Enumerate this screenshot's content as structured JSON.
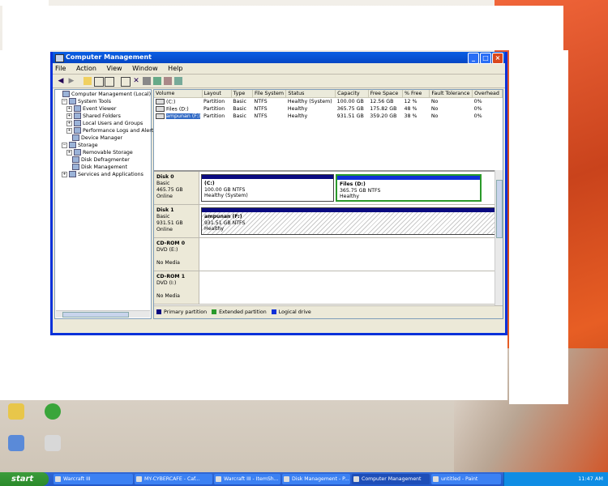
{
  "window": {
    "title": "Computer Management",
    "menu": [
      "File",
      "Action",
      "View",
      "Window",
      "Help"
    ]
  },
  "tree": [
    {
      "label": "Computer Management (Local)",
      "indent": 0,
      "expander": ""
    },
    {
      "label": "System Tools",
      "indent": 1,
      "expander": "−"
    },
    {
      "label": "Event Viewer",
      "indent": 2,
      "expander": "+"
    },
    {
      "label": "Shared Folders",
      "indent": 2,
      "expander": "+"
    },
    {
      "label": "Local Users and Groups",
      "indent": 2,
      "expander": "+"
    },
    {
      "label": "Performance Logs and Alerts",
      "indent": 2,
      "expander": "+"
    },
    {
      "label": "Device Manager",
      "indent": 2,
      "expander": ""
    },
    {
      "label": "Storage",
      "indent": 1,
      "expander": "−"
    },
    {
      "label": "Removable Storage",
      "indent": 2,
      "expander": "+"
    },
    {
      "label": "Disk Defragmenter",
      "indent": 2,
      "expander": ""
    },
    {
      "label": "Disk Management",
      "indent": 2,
      "expander": ""
    },
    {
      "label": "Services and Applications",
      "indent": 1,
      "expander": "+"
    }
  ],
  "volumes": {
    "columns": [
      "Volume",
      "Layout",
      "Type",
      "File System",
      "Status",
      "Capacity",
      "Free Space",
      "% Free",
      "Fault Tolerance",
      "Overhead"
    ],
    "rows": [
      [
        "(C:)",
        "Partition",
        "Basic",
        "NTFS",
        "Healthy (System)",
        "100.00 GB",
        "12.56 GB",
        "12 %",
        "No",
        "0%"
      ],
      [
        "Files (D:)",
        "Partition",
        "Basic",
        "NTFS",
        "Healthy",
        "365.75 GB",
        "175.82 GB",
        "48 %",
        "No",
        "0%"
      ],
      [
        "ampunan (F:)",
        "Partition",
        "Basic",
        "NTFS",
        "Healthy",
        "931.51 GB",
        "359.20 GB",
        "38 %",
        "No",
        "0%"
      ]
    ]
  },
  "disks": [
    {
      "name": "Disk 0",
      "type": "Basic",
      "size": "465.75 GB",
      "state": "Online"
    },
    {
      "name": "Disk 1",
      "type": "Basic",
      "size": "931.51 GB",
      "state": "Online"
    },
    {
      "name": "CD-ROM 0",
      "type": "DVD (E:)",
      "size": "",
      "state": "No Media"
    },
    {
      "name": "CD-ROM 1",
      "type": "DVD (I:)",
      "size": "",
      "state": "No Media"
    }
  ],
  "partitions": {
    "c": {
      "name": "(C:)",
      "detail": "100.00 GB NTFS",
      "status": "Healthy (System)"
    },
    "d": {
      "name": "Files  (D:)",
      "detail": "365.75 GB NTFS",
      "status": "Healthy"
    },
    "f": {
      "name": "ampunan  (F:)",
      "detail": "931.51 GB NTFS",
      "status": "Healthy"
    }
  },
  "legend": [
    {
      "label": "Primary partition",
      "color": "#0a0a80"
    },
    {
      "label": "Extended partition",
      "color": "#2a9a2a"
    },
    {
      "label": "Logical drive",
      "color": "#1030d8"
    }
  ],
  "taskbar": {
    "start": "start",
    "tasks": [
      "Warcraft III",
      "MY-CYBERCAFE - Caf...",
      "Warcraft III - ItemSh...",
      "Disk Management - P...",
      "Computer Management",
      "untitled - Paint"
    ],
    "clock": "11:47 AM"
  },
  "colors": {
    "titlebar": "#0a5fe4",
    "selection": "#316ac5",
    "taskbar": "#2358c8"
  }
}
